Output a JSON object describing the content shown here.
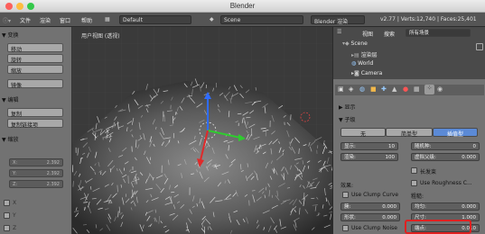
{
  "window": {
    "title": "Blender"
  },
  "infobar": {
    "menus": [
      "文件",
      "渲染",
      "窗口",
      "帮助"
    ],
    "layout": "Default",
    "scene": "Scene",
    "engine": "Blender 渲染",
    "stats": "v2.77 | Verts:12,740 | Faces:25,401"
  },
  "toolshelf": {
    "transform_header": "▼ 变换",
    "transform_buttons": [
      "移动",
      "旋转",
      "缩放",
      "镜像"
    ],
    "edit_header": "▼ 编辑",
    "edit_buttons": [
      "复制",
      "复制链接项"
    ],
    "redo_header": "▼ 缩放",
    "redo_fields": [
      {
        "label": "X:",
        "value": "2.392"
      },
      {
        "label": "Y:",
        "value": "2.392"
      },
      {
        "label": "Z:",
        "value": "2.392"
      }
    ],
    "axis_labels": [
      "X",
      "Y",
      "Z"
    ]
  },
  "viewport": {
    "label": "用户视图 (透视)"
  },
  "properties": {
    "view_tab": "视图",
    "search_tab": "搜索",
    "filter": "所有场景",
    "outliner": [
      {
        "name": "Scene",
        "indent": 0
      },
      {
        "name": "渲染层",
        "indent": 1
      },
      {
        "name": "World",
        "indent": 1
      },
      {
        "name": "Camera",
        "indent": 1
      }
    ],
    "display_header": "▶ 显示",
    "children_header": "▼ 子级",
    "child_modes": [
      "无",
      "简单型",
      "插值型"
    ],
    "display_label": "显示:",
    "display_value": "10",
    "render_label": "渲染:",
    "render_value": "100",
    "seed_label": "随机种:",
    "seed_value": "0",
    "virtual_label": "虚拟父级:",
    "virtual_value": "0.000",
    "long_hair": "长发束",
    "use_roughness": "Use Roughness C...",
    "effect_label": "效果:",
    "use_clump_curve": "Use Clump Curve",
    "clump_label": "簇:",
    "clump_value": "0.000",
    "shape_label": "形状:",
    "shape_value": "0.000",
    "use_clump_noise": "Use Clump Noise",
    "rough_label": "粗糙:",
    "uniform_label": "均匀:",
    "uniform_value": "0.000",
    "size_label": "尺寸:",
    "size_value": "1.000",
    "endpoint_label": "端点:",
    "endpoint_value": "0.010"
  }
}
